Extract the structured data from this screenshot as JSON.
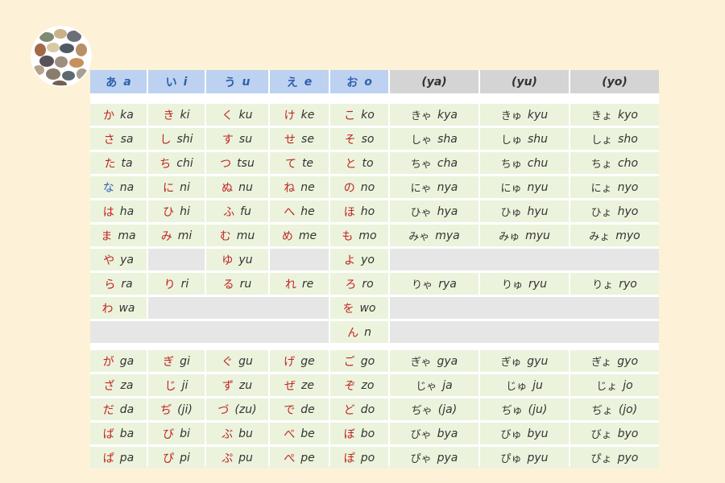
{
  "logo": {
    "icon": "pebbles-logo-icon"
  },
  "headers": [
    {
      "kana": "あ",
      "romaji": "a",
      "style": "blue"
    },
    {
      "kana": "い",
      "romaji": "i",
      "style": "blue"
    },
    {
      "kana": "う",
      "romaji": "u",
      "style": "blue"
    },
    {
      "kana": "え",
      "romaji": "e",
      "style": "blue"
    },
    {
      "kana": "お",
      "romaji": "o",
      "style": "blue"
    },
    {
      "kana": "",
      "romaji": "(ya)",
      "style": "grey"
    },
    {
      "kana": "",
      "romaji": "(yu)",
      "style": "grey"
    },
    {
      "kana": "",
      "romaji": "(yo)",
      "style": "grey"
    }
  ],
  "rows": [
    [
      [
        "か",
        "ka"
      ],
      [
        "き",
        "ki"
      ],
      [
        "く",
        "ku"
      ],
      [
        "け",
        "ke"
      ],
      [
        "こ",
        "ko"
      ],
      [
        "きゃ",
        "kya"
      ],
      [
        "きゅ",
        "kyu"
      ],
      [
        "きょ",
        "kyo"
      ]
    ],
    [
      [
        "さ",
        "sa"
      ],
      [
        "し",
        "shi"
      ],
      [
        "す",
        "su"
      ],
      [
        "せ",
        "se"
      ],
      [
        "そ",
        "so"
      ],
      [
        "しゃ",
        "sha"
      ],
      [
        "しゅ",
        "shu"
      ],
      [
        "しょ",
        "sho"
      ]
    ],
    [
      [
        "た",
        "ta"
      ],
      [
        "ち",
        "chi"
      ],
      [
        "つ",
        "tsu"
      ],
      [
        "て",
        "te"
      ],
      [
        "と",
        "to"
      ],
      [
        "ちゃ",
        "cha"
      ],
      [
        "ちゅ",
        "chu"
      ],
      [
        "ちょ",
        "cho"
      ]
    ],
    [
      [
        "な",
        "na"
      ],
      [
        "に",
        "ni"
      ],
      [
        "ぬ",
        "nu"
      ],
      [
        "ね",
        "ne"
      ],
      [
        "の",
        "no"
      ],
      [
        "にゃ",
        "nya"
      ],
      [
        "にゅ",
        "nyu"
      ],
      [
        "にょ",
        "nyo"
      ]
    ],
    [
      [
        "は",
        "ha"
      ],
      [
        "ひ",
        "hi"
      ],
      [
        "ふ",
        "fu"
      ],
      [
        "へ",
        "he"
      ],
      [
        "ほ",
        "ho"
      ],
      [
        "ひゃ",
        "hya"
      ],
      [
        "ひゅ",
        "hyu"
      ],
      [
        "ひょ",
        "hyo"
      ]
    ],
    [
      [
        "ま",
        "ma"
      ],
      [
        "み",
        "mi"
      ],
      [
        "む",
        "mu"
      ],
      [
        "め",
        "me"
      ],
      [
        "も",
        "mo"
      ],
      [
        "みゃ",
        "mya"
      ],
      [
        "みゅ",
        "myu"
      ],
      [
        "みょ",
        "myo"
      ]
    ],
    [
      [
        "や",
        "ya"
      ],
      null,
      [
        "ゆ",
        "yu"
      ],
      null,
      [
        "よ",
        "yo"
      ],
      null,
      null,
      null
    ],
    [
      [
        "ら",
        "ra"
      ],
      [
        "り",
        "ri"
      ],
      [
        "る",
        "ru"
      ],
      [
        "れ",
        "re"
      ],
      [
        "ろ",
        "ro"
      ],
      [
        "りゃ",
        "rya"
      ],
      [
        "りゅ",
        "ryu"
      ],
      [
        "りょ",
        "ryo"
      ]
    ],
    [
      [
        "わ",
        "wa"
      ],
      null,
      null,
      null,
      [
        "を",
        "wo"
      ],
      null,
      null,
      null
    ],
    [
      null,
      null,
      null,
      null,
      [
        "ん",
        "n"
      ],
      null,
      null,
      null
    ],
    [
      [
        "が",
        "ga"
      ],
      [
        "ぎ",
        "gi"
      ],
      [
        "ぐ",
        "gu"
      ],
      [
        "げ",
        "ge"
      ],
      [
        "ご",
        "go"
      ],
      [
        "ぎゃ",
        "gya"
      ],
      [
        "ぎゅ",
        "gyu"
      ],
      [
        "ぎょ",
        "gyo"
      ]
    ],
    [
      [
        "ざ",
        "za"
      ],
      [
        "じ",
        "ji"
      ],
      [
        "ず",
        "zu"
      ],
      [
        "ぜ",
        "ze"
      ],
      [
        "ぞ",
        "zo"
      ],
      [
        "じゃ",
        "ja"
      ],
      [
        "じゅ",
        "ju"
      ],
      [
        "じょ",
        "jo"
      ]
    ],
    [
      [
        "だ",
        "da"
      ],
      [
        "ぢ",
        "(ji)"
      ],
      [
        "づ",
        "(zu)"
      ],
      [
        "で",
        "de"
      ],
      [
        "ど",
        "do"
      ],
      [
        "ぢゃ",
        "(ja)"
      ],
      [
        "ぢゅ",
        "(ju)"
      ],
      [
        "ぢょ",
        "(jo)"
      ]
    ],
    [
      [
        "ば",
        "ba"
      ],
      [
        "び",
        "bi"
      ],
      [
        "ぶ",
        "bu"
      ],
      [
        "べ",
        "be"
      ],
      [
        "ぼ",
        "bo"
      ],
      [
        "びゃ",
        "bya"
      ],
      [
        "びゅ",
        "byu"
      ],
      [
        "びょ",
        "byo"
      ]
    ],
    [
      [
        "ぱ",
        "pa"
      ],
      [
        "ぴ",
        "pi"
      ],
      [
        "ぷ",
        "pu"
      ],
      [
        "ぺ",
        "pe"
      ],
      [
        "ぽ",
        "po"
      ],
      [
        "ぴゃ",
        "pya"
      ],
      [
        "ぴゅ",
        "pyu"
      ],
      [
        "ぴょ",
        "pyo"
      ]
    ]
  ],
  "colors": {
    "background": "#fdf2d8",
    "header_blue": "#bcd2f0",
    "header_grey": "#d4d4d4",
    "cell_green": "#ebf3dc",
    "cell_empty": "#e6e6e6",
    "kana_red": "#c22222",
    "kana_blue": "#2f5fb0"
  }
}
